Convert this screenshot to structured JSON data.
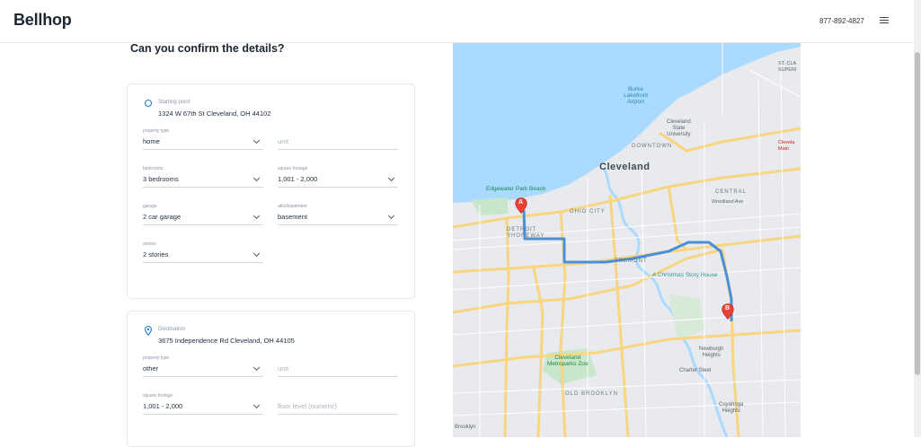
{
  "header": {
    "logo": "Bellhop",
    "phone": "877-892-4827"
  },
  "page": {
    "title": "Can you confirm the details?"
  },
  "start": {
    "heading": "Starting point",
    "address": "1324 W 67th St Cleveland, OH 44102",
    "property_type_label": "property type",
    "property_type": "home",
    "unit_placeholder": "unit",
    "bedrooms_label": "bedrooms",
    "bedrooms": "3 bedrooms",
    "sqft_label": "square footage",
    "sqft": "1,001 - 2,000",
    "garage_label": "garage",
    "garage": "2 car garage",
    "attic_label": "attic/basement",
    "attic": "basement",
    "stories_label": "stories",
    "stories": "2 stories"
  },
  "destination": {
    "heading": "Destination",
    "address": "3675 Independence Rd Cleveland, OH 44105",
    "property_type_label": "property type",
    "property_type": "other",
    "unit_placeholder": "unit",
    "sqft_label": "square footage",
    "sqft": "1,001 - 2,000",
    "floor_placeholder": "floor level (numeric)"
  },
  "map": {
    "city": "Cleveland",
    "labels": {
      "burke": "Burke\nLakefront\nAirport",
      "csu": "Cleveland\nState\nUniversity",
      "downtown": "DOWNTOWN",
      "edgewater": "Edgewater Park Beach",
      "ohio_city": "OHIO CITY",
      "detroit": "DETROIT\nSHOREWAY",
      "central": "CENTRAL",
      "tremont": "TREMONT",
      "christmas": "A Christmas Story House",
      "zoo": "Cleveland\nMetroparks Zoo",
      "old_brooklyn": "OLD BROOKLYN",
      "newburgh": "Newburgh\nHeights",
      "charter": "Charter Steel",
      "cuyahoga": "Cuyahoga\nHeights",
      "brooklyn": "Brooklyn",
      "st_clair": "ST. CLA\nSUPERI",
      "cleveland_main": "Clevela\nMain",
      "woodland": "Woodland Ave"
    },
    "marker_a": "A",
    "marker_b": "B",
    "water_color": "#aadaff",
    "route_color": "#4a90d9",
    "marker_color": "#ea4335"
  }
}
